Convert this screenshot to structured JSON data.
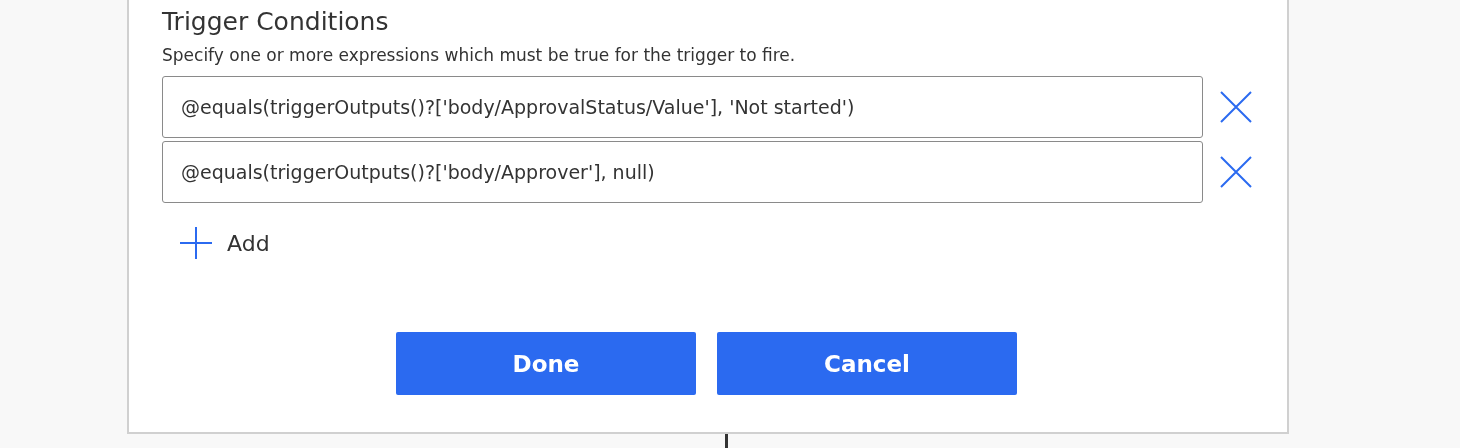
{
  "section": {
    "title": "Trigger Conditions",
    "description": "Specify one or more expressions which must be true for the trigger to fire."
  },
  "conditions": [
    {
      "value": "@equals(triggerOutputs()?['body/ApprovalStatus/Value'], 'Not started')"
    },
    {
      "value": "@equals(triggerOutputs()?['body/Approver'], null)"
    }
  ],
  "add_button": {
    "label": "Add"
  },
  "buttons": [
    {
      "label": "Done"
    },
    {
      "label": "Cancel"
    }
  ]
}
